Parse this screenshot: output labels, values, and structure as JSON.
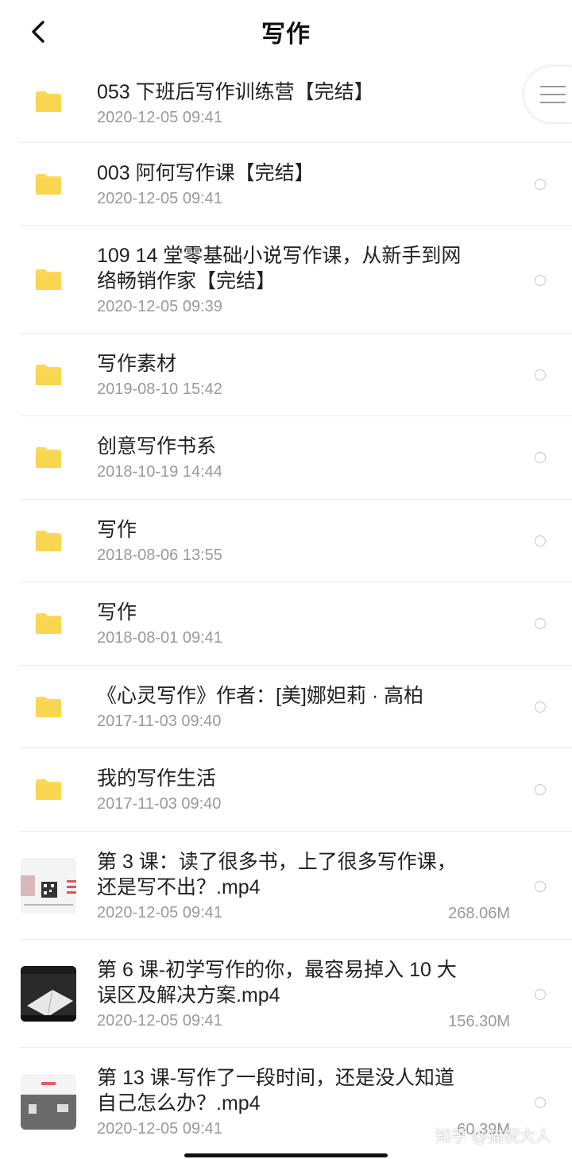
{
  "header": {
    "title": "写作"
  },
  "items": [
    {
      "name": "053 下班后写作训练营【完结】",
      "date": "2020-12-05 09:41"
    },
    {
      "name": "003 阿何写作课【完结】",
      "date": "2020-12-05 09:41"
    },
    {
      "name": "109 14 堂零基础小说写作课，从新手到网络畅销作家【完结】",
      "date": "2020-12-05 09:39"
    },
    {
      "name": "写作素材",
      "date": "2019-08-10 15:42"
    },
    {
      "name": "创意写作书系",
      "date": "2018-10-19 14:44"
    },
    {
      "name": "写作",
      "date": "2018-08-06 13:55"
    },
    {
      "name": "写作",
      "date": "2018-08-01 09:41"
    },
    {
      "name": "《心灵写作》作者：[美]娜妲莉 · 高柏",
      "date": "2017-11-03 09:40"
    },
    {
      "name": "我的写作生活",
      "date": "2017-11-03 09:40"
    },
    {
      "name": "第 3 课：读了很多书，上了很多写作课，还是写不出？.mp4",
      "date": "2020-12-05 09:41",
      "size": "268.06M"
    },
    {
      "name": "第 6 课-初学写作的你，最容易掉入 10 大误区及解决方案.mp4",
      "date": "2020-12-05 09:41",
      "size": "156.30M"
    },
    {
      "name": "第 13 课-写作了一段时间，还是没人知道自己怎么办？.mp4",
      "date": "2020-12-05 09:41",
      "size": "60.39M"
    }
  ],
  "watermark": "知乎 @猫祝大人",
  "icons": {
    "back": "chevron-left-icon",
    "folder": "folder-icon",
    "menu": "menu-icon",
    "thumb": "video-thumbnail-icon",
    "select": "radio-circle-icon"
  },
  "colors": {
    "folder": "#FAD85A",
    "folder_dark": "#F2C94C",
    "date": "#9a9a9a",
    "divider": "#ececec"
  }
}
